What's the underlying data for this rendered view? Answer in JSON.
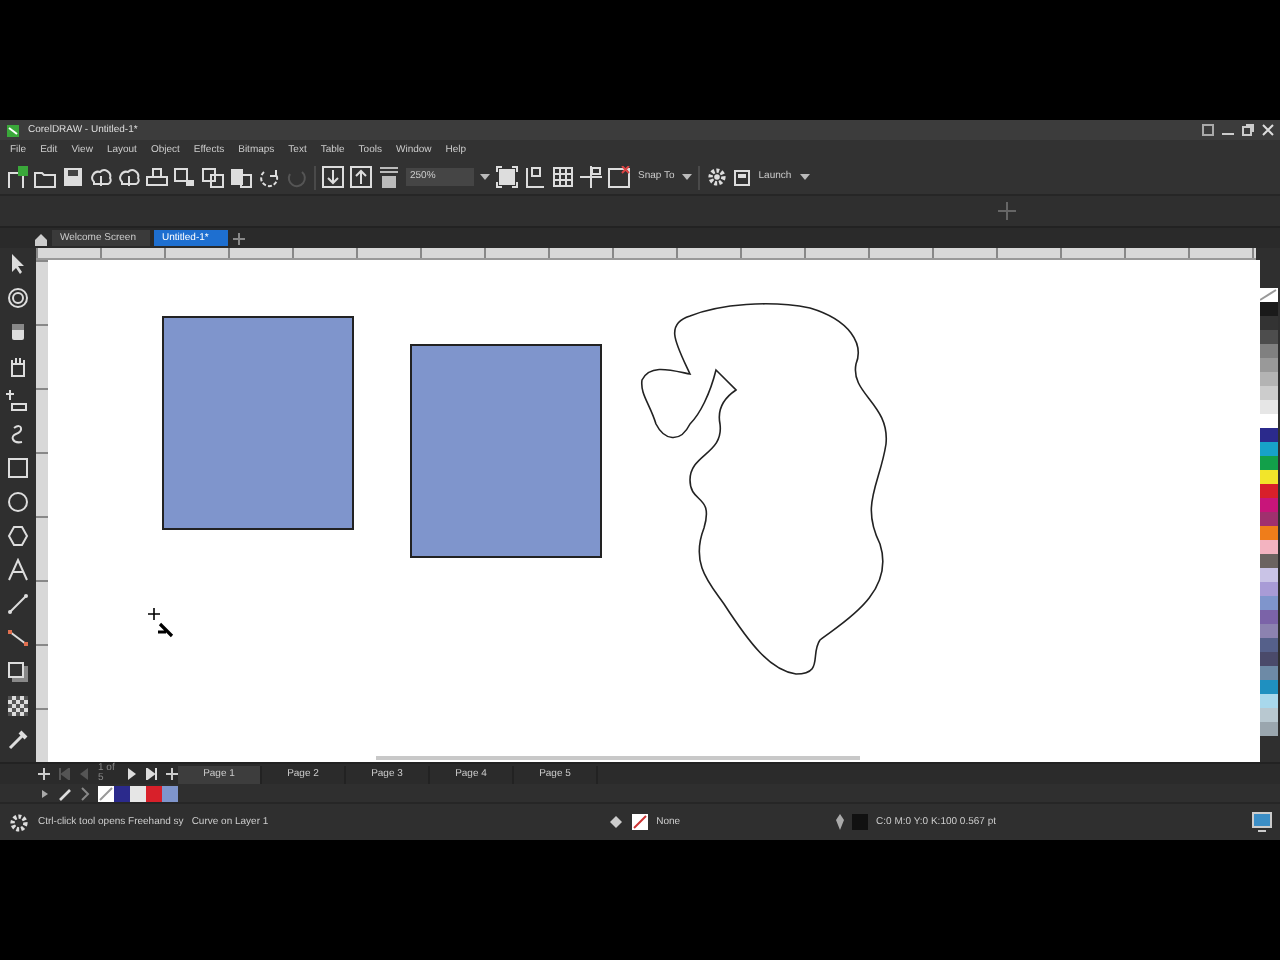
{
  "window": {
    "title": "CorelDRAW - Untitled-1*"
  },
  "menu": [
    "File",
    "Edit",
    "View",
    "Layout",
    "Object",
    "Effects",
    "Bitmaps",
    "Text",
    "Table",
    "Tools",
    "Window",
    "Help"
  ],
  "toolbar": {
    "zoom": "250%",
    "snap": "Snap To",
    "launch": "Launch"
  },
  "doc_tabs": [
    {
      "label": "Welcome Screen",
      "selected": false
    },
    {
      "label": "Untitled-1*",
      "selected": true
    }
  ],
  "page_nav": {
    "counter": "1 of 5"
  },
  "pages": [
    {
      "label": "Page 1",
      "selected": true
    },
    {
      "label": "Page 2",
      "selected": false
    },
    {
      "label": "Page 3",
      "selected": false
    },
    {
      "label": "Page 4",
      "selected": false
    },
    {
      "label": "Page 5",
      "selected": false
    }
  ],
  "document_palette": [
    {
      "color": "#2b2a8c"
    },
    {
      "color": "#e6e6e6"
    },
    {
      "color": "#d8202a"
    },
    {
      "color": "#7f95cc"
    }
  ],
  "palette": [
    {
      "color": "#1a1a1a"
    },
    {
      "color": "#333333"
    },
    {
      "color": "#4d4d4d"
    },
    {
      "color": "#808080"
    },
    {
      "color": "#999999"
    },
    {
      "color": "#b3b3b3"
    },
    {
      "color": "#cccccc"
    },
    {
      "color": "#e6e6e6"
    },
    {
      "color": "#ffffff"
    },
    {
      "color": "#2b2a8c"
    },
    {
      "color": "#17a2c8"
    },
    {
      "color": "#12a04a"
    },
    {
      "color": "#f2e52a"
    },
    {
      "color": "#d8202a"
    },
    {
      "color": "#c8157a"
    },
    {
      "color": "#a0306e"
    },
    {
      "color": "#ef7d1a"
    },
    {
      "color": "#f3b3c0"
    },
    {
      "color": "#6b6360"
    },
    {
      "color": "#c9c3e6"
    },
    {
      "color": "#a89bd6"
    },
    {
      "color": "#7f95cc"
    },
    {
      "color": "#7b63a8"
    },
    {
      "color": "#8c82b0"
    },
    {
      "color": "#55608a"
    },
    {
      "color": "#4a4a6a"
    },
    {
      "color": "#6d8aa6"
    },
    {
      "color": "#1f90c0"
    },
    {
      "color": "#a8d8ec"
    },
    {
      "color": "#b8c8d0"
    },
    {
      "color": "#9aa6ae"
    }
  ],
  "status_bar": {
    "hint": "Ctrl-click tool opens Freehand sy",
    "object": "Curve on Layer 1",
    "fill": "None",
    "outline": "C:0 M:0 Y:0 K:100 0.567 pt"
  }
}
